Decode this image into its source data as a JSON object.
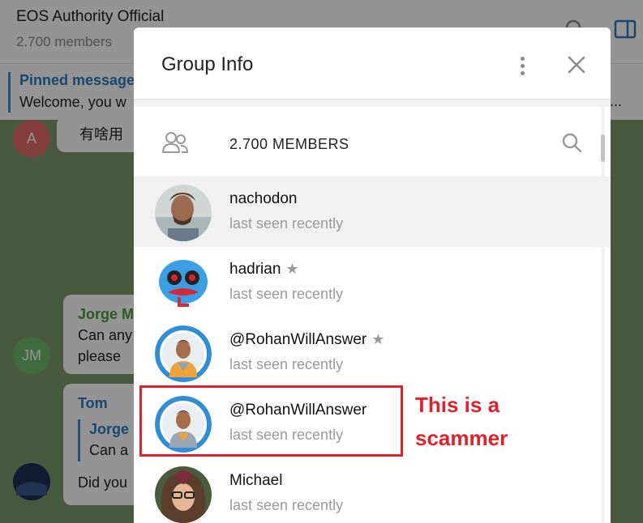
{
  "chat": {
    "title": "EOS Authority Official",
    "subtitle": "2.700 members",
    "pinned_title": "Pinned message",
    "pinned_text": "Welcome, you w",
    "pinned_ellipsis": "...",
    "messages": [
      {
        "avatar_letter": "A",
        "avatar_color": "#e46a6a",
        "text": "有啥用"
      },
      {
        "avatar_letter": "JM",
        "avatar_color": "#6fb86b",
        "author": "Jorge M",
        "author_color": "#4f9a3c",
        "line1": "Can any",
        "line2": "please"
      },
      {
        "author": "Tom",
        "author_color": "#2a7bbf",
        "quote_author": "Jorge",
        "quote_text": "Can a",
        "text": "Did you"
      }
    ]
  },
  "modal": {
    "title": "Group Info",
    "members_count": "2.700 MEMBERS",
    "members": [
      {
        "name": "nachodon",
        "status": "last seen recently",
        "star": false
      },
      {
        "name": "hadrian",
        "status": "last seen recently",
        "star": true
      },
      {
        "name": "@RohanWillAnswer",
        "status": "last seen recently",
        "star": true
      },
      {
        "name": "@RohanWillAnswer",
        "status": "last seen recently",
        "star": false
      },
      {
        "name": "Michael",
        "status": "last seen recently",
        "star": false
      }
    ],
    "star_glyph": "★"
  },
  "annotation": {
    "text": "This is a scammer",
    "color": "#e0202b"
  },
  "colors": {
    "accent": "#2a7bbf",
    "chat_bg": "#7d9a6e",
    "status_gray": "#9a9a9a"
  },
  "icons": [
    "search-icon",
    "side-panel-icon",
    "more-vertical-icon",
    "close-icon",
    "members-icon",
    "star-icon"
  ]
}
